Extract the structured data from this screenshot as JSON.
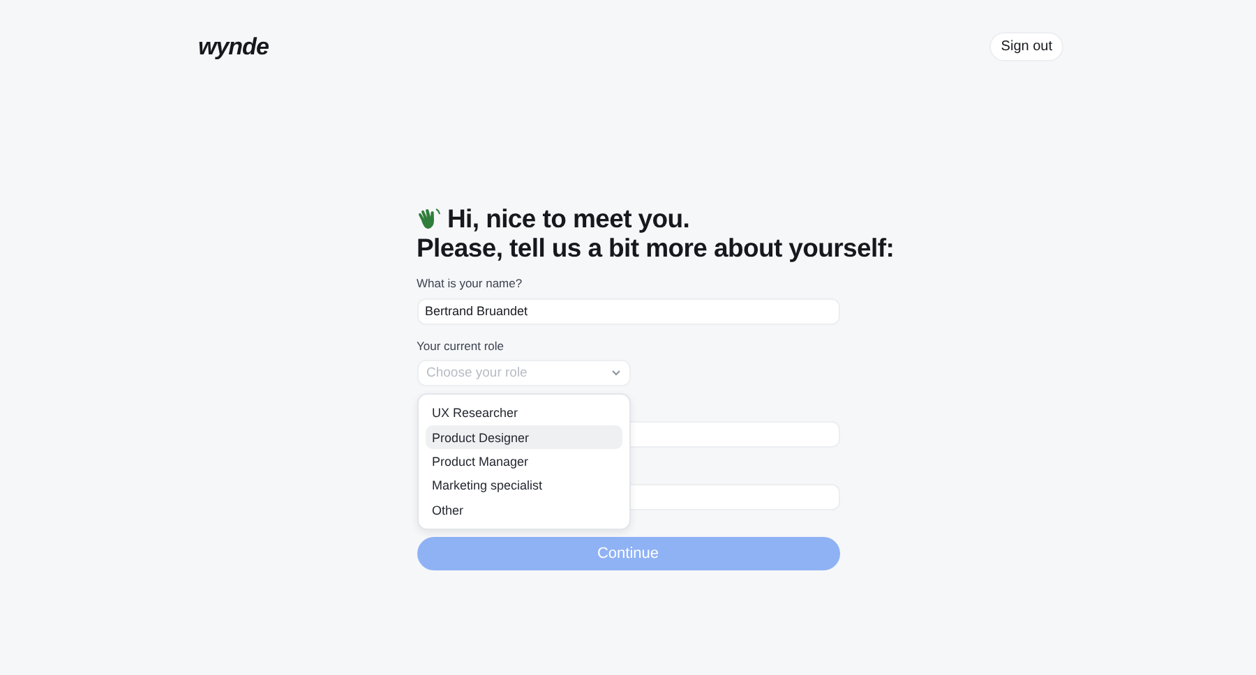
{
  "header": {
    "logo": "wynde",
    "sign_out": "Sign out"
  },
  "heading": {
    "line_1": "Hi, nice to meet you.",
    "line_2": "Please, tell us a bit more about yourself:"
  },
  "fields": [
    {
      "kind": "text",
      "label": "What is your name?",
      "value": "Bertrand Bruandet"
    },
    {
      "kind": "select",
      "label": "Your current role",
      "placeholder": "Choose your role",
      "expanded": true,
      "options": [
        {
          "label": "UX Researcher",
          "selected": false
        },
        {
          "label": "Product Designer",
          "selected": true
        },
        {
          "label": "Product Manager",
          "selected": false
        },
        {
          "label": "Marketing specialist",
          "selected": false
        },
        {
          "label": "Other",
          "selected": false
        }
      ]
    },
    {
      "kind": "text"
    },
    {
      "kind": "text"
    }
  ],
  "continue": {
    "label": "Continue",
    "disabled": true
  }
}
